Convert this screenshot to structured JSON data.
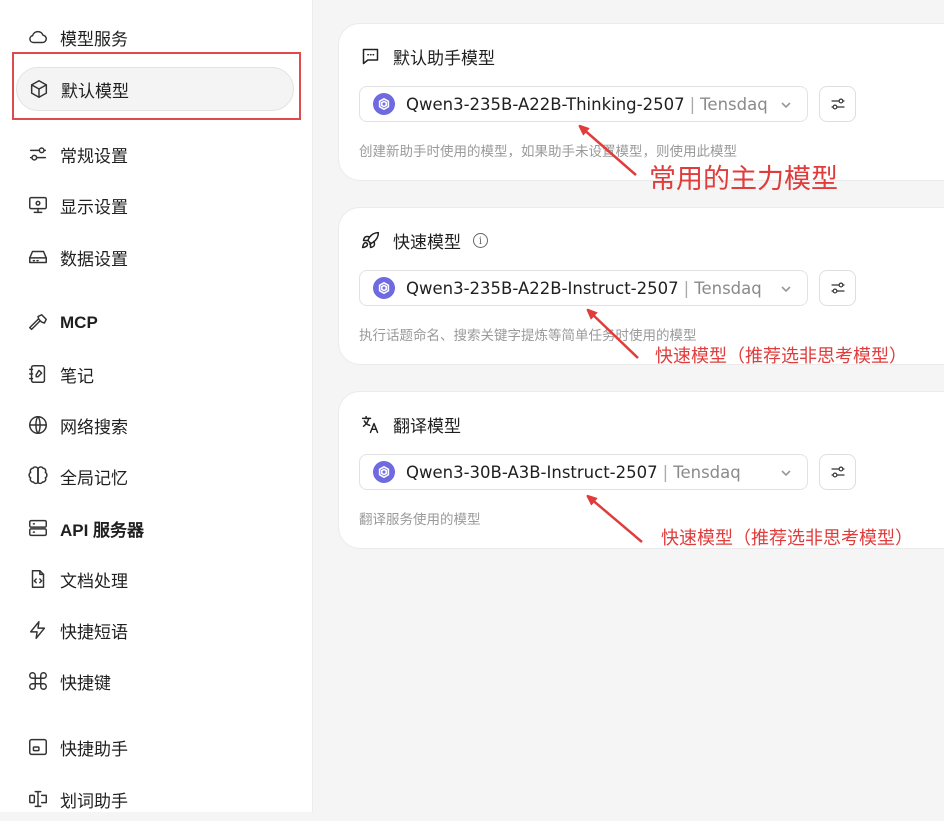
{
  "sidebar": {
    "items": [
      {
        "label": "模型服务",
        "icon": "cloud-icon"
      },
      {
        "label": "默认模型",
        "icon": "cube-icon",
        "active": true
      },
      {
        "label": "常规设置",
        "icon": "sliders-icon"
      },
      {
        "label": "显示设置",
        "icon": "monitor-gear-icon"
      },
      {
        "label": "数据设置",
        "icon": "hard-drive-icon"
      },
      {
        "label": "MCP",
        "icon": "hammer-icon"
      },
      {
        "label": "笔记",
        "icon": "notebook-icon"
      },
      {
        "label": "网络搜索",
        "icon": "globe-icon"
      },
      {
        "label": "全局记忆",
        "icon": "brain-icon"
      },
      {
        "label": "API 服务器",
        "icon": "server-icon"
      },
      {
        "label": "文档处理",
        "icon": "file-code-icon"
      },
      {
        "label": "快捷短语",
        "icon": "zap-icon"
      },
      {
        "label": "快捷键",
        "icon": "command-icon"
      },
      {
        "label": "快捷助手",
        "icon": "app-window-icon"
      },
      {
        "label": "划词助手",
        "icon": "text-cursor-icon"
      }
    ]
  },
  "cards": [
    {
      "title": "默认助手模型",
      "icon": "message-square-icon",
      "model": "Qwen3-235B-A22B-Thinking-2507",
      "provider": "Tensdaq",
      "hint": "创建新助手时使用的模型，如果助手未设置模型，则使用此模型"
    },
    {
      "title": "快速模型",
      "icon": "rocket-icon",
      "model": "Qwen3-235B-A22B-Instruct-2507",
      "provider": "Tensdaq",
      "hint": "执行话题命名、搜索关键字提炼等简单任务时使用的模型"
    },
    {
      "title": "翻译模型",
      "icon": "languages-icon",
      "model": "Qwen3-30B-A3B-Instruct-2507",
      "provider": "Tensdaq",
      "hint": "翻译服务使用的模型"
    }
  ],
  "annotations": {
    "main": "常用的主力模型",
    "fast": "快速模型（推荐选非思考模型）",
    "translate": "快速模型（推荐选非思考模型）"
  },
  "colors": {
    "annotation": "#e03c3c",
    "model_logo": "#6f6ae0"
  }
}
